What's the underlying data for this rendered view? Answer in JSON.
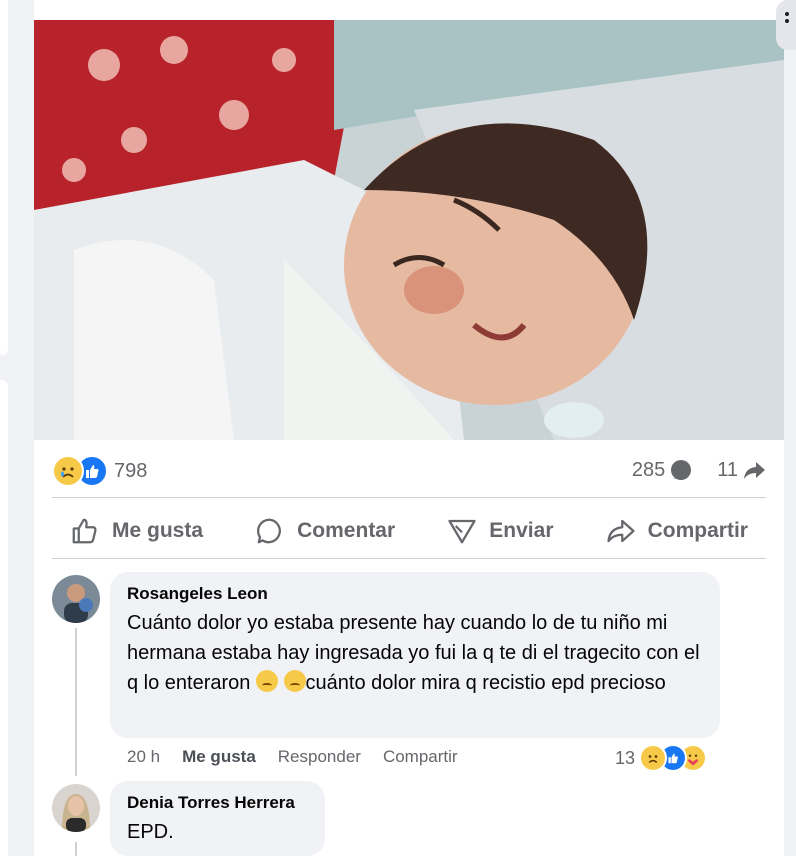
{
  "post": {
    "reaction_count": "798",
    "comment_count": "285",
    "share_count": "11",
    "actions": {
      "like": "Me gusta",
      "comment": "Comentar",
      "send": "Enviar",
      "share": "Compartir"
    }
  },
  "comments": [
    {
      "author": "Rosangeles Leon",
      "text_part1": "Cuánto dolor yo estaba presente hay cuando lo de tu niño mi hermana estaba hay ingresada yo fui la q te di el tragecito con el q lo enteraron ",
      "text_part2": "cuánto dolor mira q recistio epd precioso",
      "time": "20 h",
      "like_label": "Me gusta",
      "reply_label": "Responder",
      "share_label": "Compartir",
      "reaction_count": "13"
    },
    {
      "author": "Denia Torres Herrera",
      "text": "EPD."
    }
  ]
}
